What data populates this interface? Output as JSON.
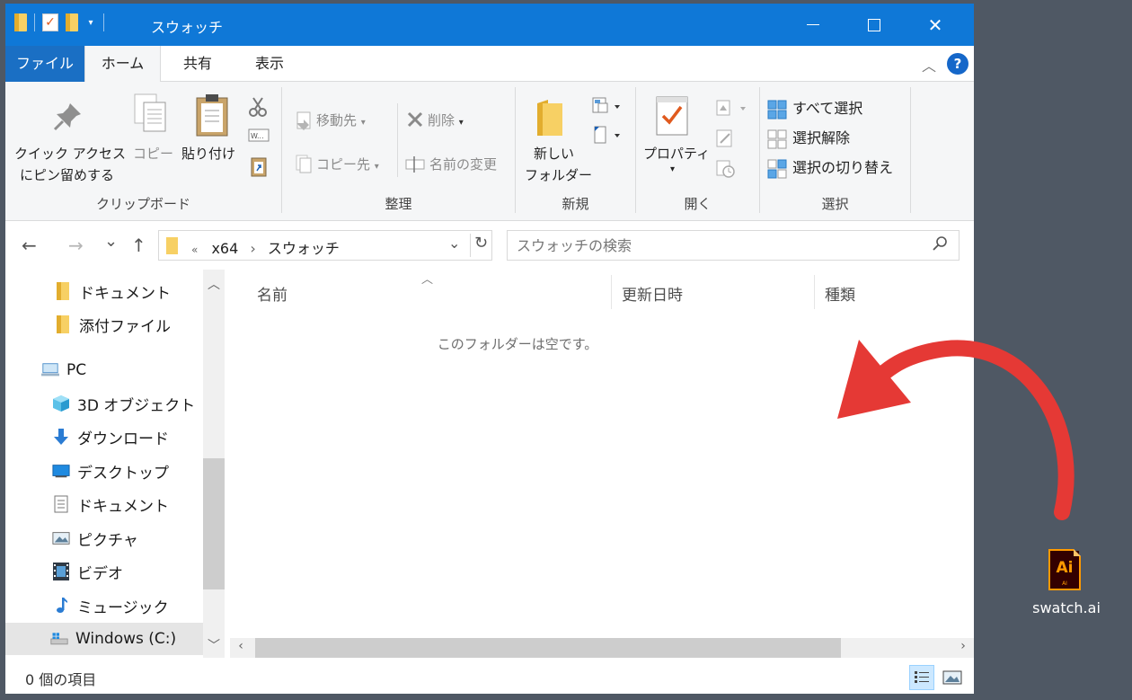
{
  "window": {
    "title": "スウォッチ",
    "min_icon": "minimize-icon",
    "max_icon": "maximize-icon",
    "close_glyph": "✕"
  },
  "tabs": {
    "file": "ファイル",
    "home": "ホーム",
    "share": "共有",
    "view": "表示",
    "collapse_glyph": "︿",
    "help_glyph": "?"
  },
  "ribbon": {
    "clipboard": {
      "pin_line1": "クイック アクセス",
      "pin_line2": "にピン留めする",
      "copy": "コピー",
      "paste": "貼り付け",
      "label": "クリップボード"
    },
    "organize": {
      "move_to": "移動先",
      "copy_to": "コピー先",
      "delete": "削除",
      "rename": "名前の変更",
      "label": "整理"
    },
    "new": {
      "folder_line1": "新しい",
      "folder_line2": "フォルダー",
      "label": "新規"
    },
    "open": {
      "properties": "プロパティ",
      "label": "開く"
    },
    "select": {
      "select_all": "すべて選択",
      "select_none": "選択解除",
      "invert": "選択の切り替え",
      "label": "選択"
    }
  },
  "navbar": {
    "back_glyph": "←",
    "forward_glyph": "→",
    "recent_glyph": "⌄",
    "up_glyph": "↑",
    "crumb_overflow": "«",
    "crumb_1": "x64",
    "crumb_sep": "›",
    "crumb_2": "スウォッチ",
    "dropdown_glyph": "⌄",
    "refresh_glyph": "↻",
    "search_placeholder": "スウォッチの検索"
  },
  "navpane": {
    "items": [
      {
        "label": "ドキュメント",
        "icon": "folder-icon"
      },
      {
        "label": "添付ファイル",
        "icon": "folder-icon"
      },
      {
        "label": "PC",
        "icon": "pc-icon"
      },
      {
        "label": "3D オブジェクト",
        "icon": "3d-objects-icon"
      },
      {
        "label": "ダウンロード",
        "icon": "download-icon"
      },
      {
        "label": "デスクトップ",
        "icon": "desktop-icon"
      },
      {
        "label": "ドキュメント",
        "icon": "documents-icon"
      },
      {
        "label": "ピクチャ",
        "icon": "pictures-icon"
      },
      {
        "label": "ビデオ",
        "icon": "videos-icon"
      },
      {
        "label": "ミュージック",
        "icon": "music-icon"
      },
      {
        "label": "Windows (C:)",
        "icon": "drive-icon"
      }
    ]
  },
  "content": {
    "columns": [
      "名前",
      "更新日時",
      "種類"
    ],
    "empty_message": "このフォルダーは空です。"
  },
  "status": {
    "item_count": "0 個の項目"
  },
  "desktop": {
    "file_name": "swatch.ai",
    "icon_text": "Ai",
    "icon_subtext": "AI"
  },
  "colors": {
    "titlebar": "#0f78d7",
    "desktop": "#4f5864",
    "arrow": "#e53935",
    "ai_icon_bg": "#330000",
    "ai_icon_fg": "#ff9a00"
  }
}
